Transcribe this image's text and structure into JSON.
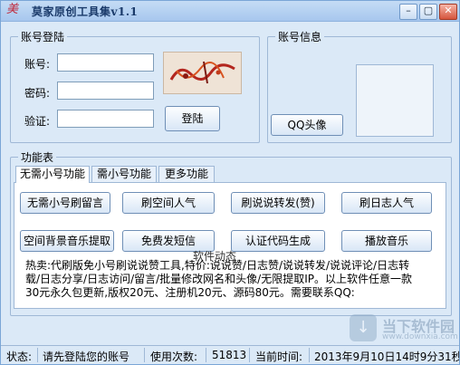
{
  "window": {
    "title": "莫家原创工具集v1.1",
    "icon": "美",
    "buttons": {
      "minimize": "–",
      "restore": "▢",
      "close": "✕"
    }
  },
  "login": {
    "group_title": "账号登陆",
    "account_label": "账号:",
    "password_label": "密码:",
    "captcha_label": "验证:",
    "account_value": "",
    "password_value": "",
    "captcha_value": "",
    "login_button": "登陆"
  },
  "account_info": {
    "group_title": "账号信息",
    "qq_avatar_button": "QQ头像"
  },
  "functions": {
    "group_title": "功能表",
    "tabs": [
      "无需小号功能",
      "需小号功能",
      "更多功能"
    ],
    "buttons_row1": [
      "无需小号刷留言",
      "刷空间人气",
      "刷说说转发(赞)",
      "刷日志人气"
    ],
    "buttons_row2": [
      "空间背景音乐提取",
      "免费发短信",
      "认证代码生成",
      "播放音乐"
    ],
    "news_title": "软件动态",
    "news_text": "热卖:代刷版免小号刷说说赞工具,特价:说说赞/日志赞/说说转发/说说评论/日志转载/日志分享/日志访问/留言/批量修改网名和头像/无限提取IP。以上软件任意一款30元永久包更新,版权20元、注册机20元、源码80元。需要联系QQ:"
  },
  "status": {
    "label": "状态:",
    "message": "请先登陆您的账号",
    "uses_label": "使用次数:",
    "uses_count": "51813",
    "time_label": "当前时间:",
    "time_value": "2013年9月10日14时9分31秒"
  },
  "watermark": {
    "logo": "↓",
    "brand": "当下软件园",
    "url": "www.downxia.com"
  },
  "colors": {
    "window_bg": "#dbe9f7",
    "title_text": "#1a3a6a",
    "group_border": "#9fb8d6"
  }
}
